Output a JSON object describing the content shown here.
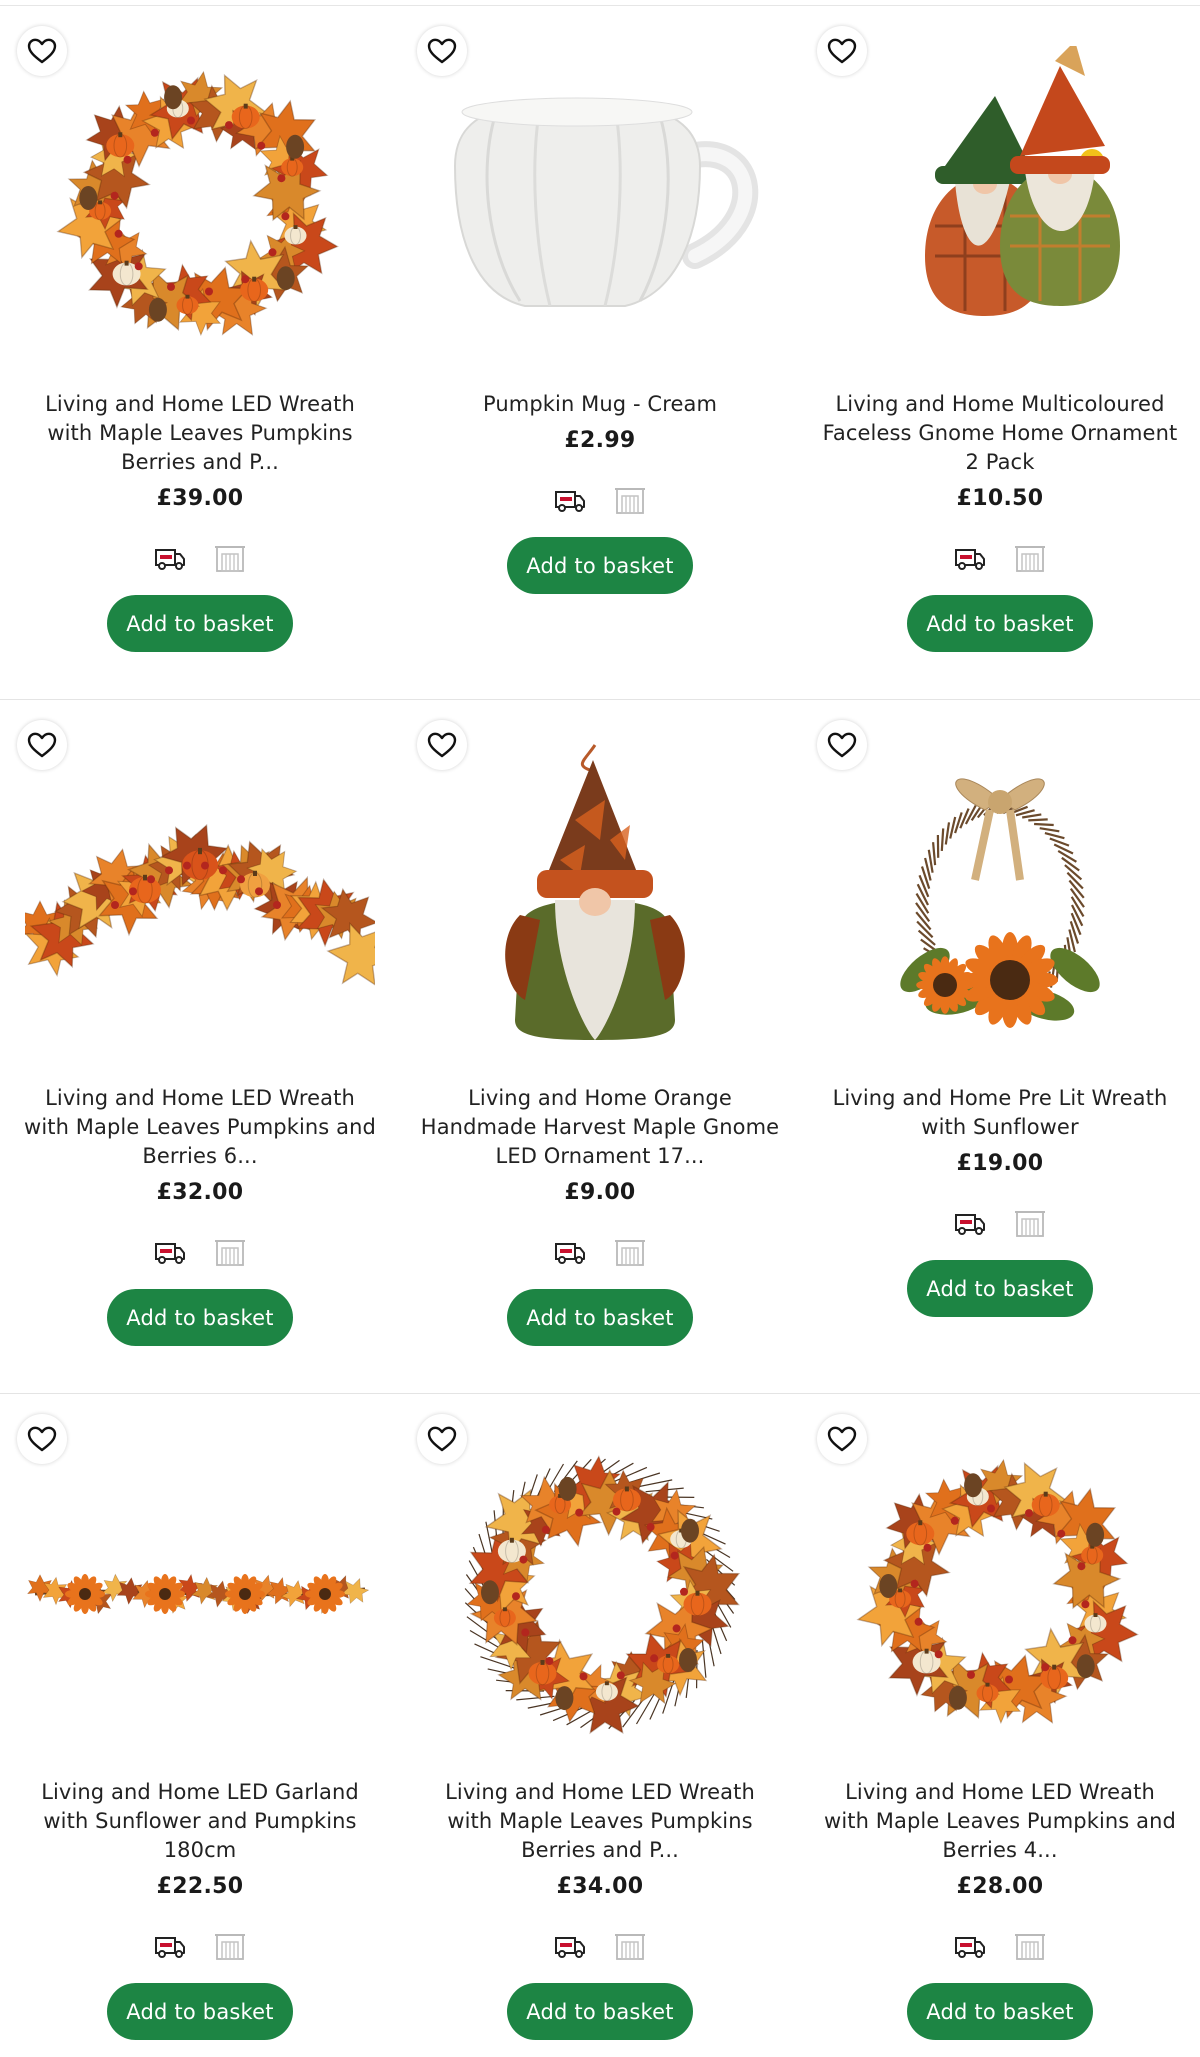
{
  "products": [
    {
      "title": "Living and Home LED Wreath with Maple Leaves Pumpkins Berries and P...",
      "price": "£39.00",
      "button": "Add to basket",
      "image": "autumn-wreath-image"
    },
    {
      "title": "Pumpkin Mug - Cream",
      "price": "£2.99",
      "button": "Add to basket",
      "image": "pumpkin-mug-image"
    },
    {
      "title": "Living and Home Multicoloured Faceless Gnome Home Ornament 2 Pack",
      "price": "£10.50",
      "button": "Add to basket",
      "image": "gnome-pair-image"
    },
    {
      "title": "Living and Home LED Wreath with Maple Leaves Pumpkins and Berries 6...",
      "price": "£32.00",
      "button": "Add to basket",
      "image": "autumn-swag-image"
    },
    {
      "title": "Living and Home Orange Handmade Harvest Maple Gnome LED Ornament 17...",
      "price": "£9.00",
      "button": "Add to basket",
      "image": "gnome-image"
    },
    {
      "title": "Living and Home Pre Lit Wreath with Sunflower",
      "price": "£19.00",
      "button": "Add to basket",
      "image": "sunflower-wreath-image"
    },
    {
      "title": "Living and Home LED Garland with Sunflower and Pumpkins 180cm",
      "price": "£22.50",
      "button": "Add to basket",
      "image": "garland-image"
    },
    {
      "title": "Living and Home LED Wreath with Maple Leaves Pumpkins Berries and P...",
      "price": "£34.00",
      "button": "Add to basket",
      "image": "maple-wreath-image"
    },
    {
      "title": "Living and Home LED Wreath with Maple Leaves Pumpkins and Berries 4...",
      "price": "£28.00",
      "button": "Add to basket",
      "image": "autumn-wreath-image"
    }
  ],
  "icons": {
    "favourite": "heart-outline-icon",
    "delivery": "delivery-van-icon",
    "collect": "store-collect-icon"
  },
  "colors": {
    "button": "#1d8544",
    "button_text": "#ffffff",
    "van_accent": "#c8102e"
  }
}
